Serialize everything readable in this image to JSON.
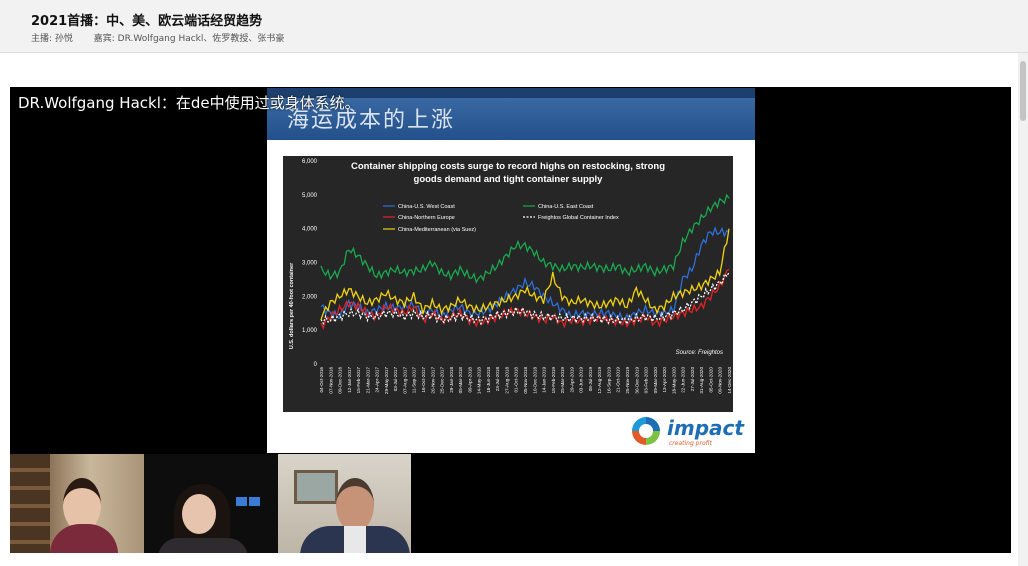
{
  "header": {
    "title": "2021首播：中、美、欧云端话经贸趋势",
    "host": "主播: 孙悦",
    "guests": "嘉宾: DR.Wolfgang Hackl、佐罗教授、张书豪"
  },
  "caption": "DR.Wolfgang Hackl：在de中使用过或身体系统。",
  "slide": {
    "title": "海运成本的上涨",
    "logo_text": "impact",
    "logo_sub": "creating profit"
  },
  "chart_data": {
    "type": "line",
    "title": "Container shipping costs surge to record highs on restocking, strong goods demand and tight container supply",
    "ylabel": "U.S. dollars per 40-foot container",
    "source": "Source: Freightos",
    "ylim": [
      0,
      6000
    ],
    "yticks": [
      "0",
      "1,000",
      "2,000",
      "3,000",
      "4,000",
      "5,000",
      "6,000"
    ],
    "x_ticks": [
      "04-Oct-2016",
      "07-Nov-2016",
      "09-Dec-2016",
      "12-Jan-2017",
      "15-Feb-2017",
      "21-Mar-2017",
      "24-Apr-2017",
      "29-May-2017",
      "03-Jul-2017",
      "07-Aug-2017",
      "11-Sep-2017",
      "16-Oct-2017",
      "20-Nov-2017",
      "25-Dec-2017",
      "29-Jan-2018",
      "05-Mar-2018",
      "09-Apr-2018",
      "14-May-2018",
      "18-Jun-2018",
      "23-Jul-2018",
      "27-Aug-2018",
      "01-Oct-2018",
      "05-Nov-2018",
      "10-Dec-2018",
      "14-Jan-2019",
      "18-Feb-2019",
      "25-Mar-2019",
      "29-Apr-2019",
      "03-Jun-2019",
      "08-Jul-2019",
      "12-Aug-2019",
      "16-Sep-2019",
      "21-Oct-2019",
      "25-Nov-2019",
      "30-Dec-2019",
      "03-Feb-2020",
      "09-Mar-2020",
      "13-Apr-2020",
      "18-May-2020",
      "22-Jun-2020",
      "27-Jul-2020",
      "31-Aug-2020",
      "05-Oct-2020",
      "09-Nov-2020",
      "14-Dec-2020"
    ],
    "series": [
      {
        "name": "China-U.S. West Coast",
        "color": "#2e6fd8",
        "values": [
          1700,
          1500,
          1400,
          1800,
          1700,
          1500,
          1600,
          1700,
          1650,
          1700,
          1750,
          1500,
          1600,
          1400,
          1600,
          1700,
          1500,
          1500,
          1600,
          1800,
          2000,
          2200,
          2400,
          2300,
          2000,
          1800,
          1600,
          1400,
          1500,
          1450,
          1500,
          1500,
          1400,
          1350,
          1500,
          1600,
          1500,
          1500,
          1600,
          2500,
          2800,
          3500,
          3900,
          3900,
          3900
        ]
      },
      {
        "name": "China-U.S. East Coast",
        "color": "#1aa84e",
        "values": [
          2800,
          2600,
          2700,
          3400,
          3200,
          2900,
          2600,
          2700,
          2800,
          2700,
          2750,
          2800,
          3000,
          2700,
          2600,
          2800,
          2600,
          2500,
          2700,
          2900,
          3200,
          3500,
          3500,
          3300,
          3000,
          2900,
          2800,
          2900,
          2850,
          2900,
          2850,
          2800,
          2900,
          2700,
          2800,
          2900,
          2700,
          2800,
          2900,
          3600,
          4000,
          4300,
          4600,
          4800,
          4900
        ]
      },
      {
        "name": "China-Northern Europe",
        "color": "#e02424",
        "values": [
          1100,
          1400,
          1600,
          1800,
          1700,
          1500,
          1400,
          1700,
          1600,
          1500,
          1700,
          1300,
          1500,
          1300,
          1400,
          1500,
          1300,
          1200,
          1300,
          1400,
          1500,
          1600,
          1500,
          1400,
          1300,
          1400,
          1200,
          1300,
          1250,
          1300,
          1350,
          1300,
          1250,
          1200,
          1300,
          1400,
          1200,
          1300,
          1400,
          1500,
          1600,
          1700,
          2000,
          2300,
          2800
        ]
      },
      {
        "name": "Freightos Global Container Index",
        "color": "#ffffff",
        "values": [
          1300,
          1300,
          1400,
          1500,
          1500,
          1400,
          1400,
          1500,
          1500,
          1400,
          1500,
          1400,
          1450,
          1300,
          1350,
          1450,
          1350,
          1300,
          1350,
          1450,
          1500,
          1550,
          1550,
          1450,
          1400,
          1400,
          1350,
          1350,
          1350,
          1350,
          1350,
          1300,
          1300,
          1300,
          1350,
          1400,
          1350,
          1400,
          1500,
          1600,
          1800,
          2000,
          2200,
          2400,
          2700
        ]
      },
      {
        "name": "China-Mediterranean (via Suez)",
        "color": "#f2d20f",
        "values": [
          1400,
          1800,
          2000,
          2200,
          2000,
          1800,
          1900,
          2100,
          1900,
          1800,
          2000,
          1600,
          1800,
          1600,
          1700,
          1900,
          1700,
          1600,
          1700,
          1800,
          1900,
          2000,
          2200,
          2000,
          1900,
          2600,
          2000,
          1800,
          1900,
          1800,
          1700,
          1800,
          1900,
          1700,
          2200,
          1900,
          1600,
          1700,
          2000,
          2100,
          2200,
          2300,
          2500,
          2700,
          4000
        ]
      }
    ]
  }
}
